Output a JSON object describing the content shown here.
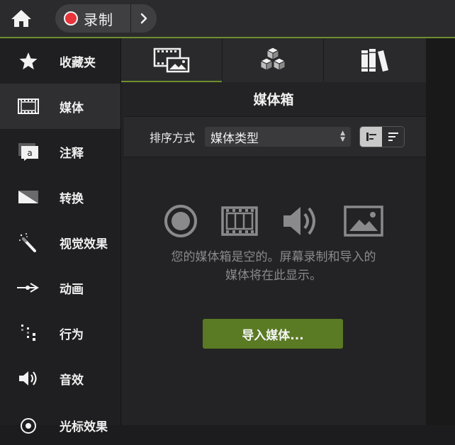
{
  "topbar": {
    "home_icon": "home-icon",
    "record_label": "录制",
    "record_icon": "record-dot-icon",
    "more_icon": "chevron-right-icon"
  },
  "sidebar": {
    "items": [
      {
        "label": "收藏夹",
        "icon": "star-icon"
      },
      {
        "label": "媒体",
        "icon": "film-icon",
        "active": true
      },
      {
        "label": "注释",
        "icon": "annotation-icon"
      },
      {
        "label": "转换",
        "icon": "transition-icon"
      },
      {
        "label": "视觉效果",
        "icon": "magic-wand-icon"
      },
      {
        "label": "动画",
        "icon": "animation-arrow-icon"
      },
      {
        "label": "行为",
        "icon": "behavior-icon"
      },
      {
        "label": "音效",
        "icon": "speaker-icon"
      },
      {
        "label": "光标效果",
        "icon": "cursor-effect-icon"
      }
    ]
  },
  "tabs": [
    {
      "name": "media-bin",
      "icon": "media-bin-icon",
      "active": true
    },
    {
      "name": "library",
      "icon": "cubes-icon"
    },
    {
      "name": "libraries",
      "icon": "books-icon"
    }
  ],
  "panel": {
    "title": "媒体箱",
    "sort_label": "排序方式",
    "sort_value": "媒体类型",
    "empty_line1": "您的媒体箱是空的。屏幕录制和导入的",
    "empty_line2": "媒体将在此显示。",
    "import_button": "导入媒体..."
  },
  "colors": {
    "accent": "#6e8f2e",
    "record": "#e8333a",
    "import_button": "#5a7a23"
  }
}
